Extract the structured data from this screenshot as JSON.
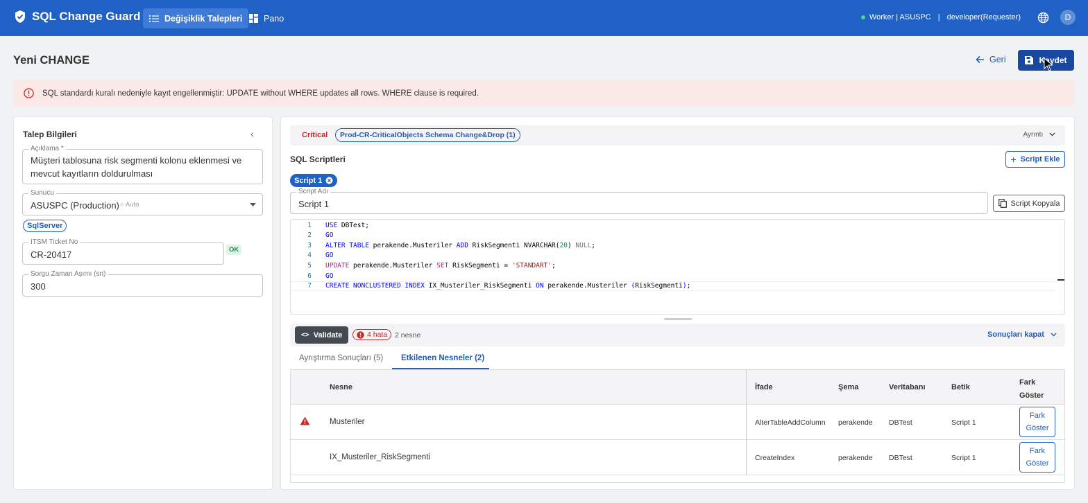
{
  "header": {
    "app_name": "SQL Change Guard",
    "nav": [
      {
        "label": "Değişiklik Talepleri",
        "active": true
      },
      {
        "label": "Pano",
        "active": false
      }
    ],
    "worker_status": "Worker | ASUSPC",
    "separator": "|",
    "user_role": "developer(Requester)",
    "avatar_initial": "D"
  },
  "page": {
    "title": "Yeni CHANGE",
    "back_label": "Geri",
    "save_label": "Kaydet"
  },
  "alert": {
    "message": "SQL standardı kuralı nedeniyle kayıt engellenmiştir: UPDATE without WHERE updates all rows. WHERE clause is required."
  },
  "request_info": {
    "title": "Talep Bilgileri",
    "description_label": "Açıklama *",
    "description_line1": "Müşteri tablosuna risk segmenti kolonu eklenmesi ve",
    "description_line2": "mevcut kayıtların doldurulması",
    "server_label": "Sunucu",
    "server_value": "ASUSPC (Production)",
    "server_hint": "Auto",
    "db_type_chip": "SqlServer",
    "itsm_label": "ITSM Ticket No",
    "itsm_value": "CR-20417",
    "itsm_status": "OK",
    "timeout_label": "Sorgu Zaman Aşımı (sn)",
    "timeout_value": "300"
  },
  "policy": {
    "level": "Critical",
    "rule_chip": "Prod-CR-CriticalObjects Schema Change&Drop (1)",
    "detail_label": "Ayrıntı"
  },
  "scripts": {
    "section_title": "SQL Scriptleri",
    "add_label": "Script Ekle",
    "tab_label": "Script 1",
    "name_label": "Script Adı",
    "name_value": "Script 1",
    "copy_label": "Script Kopyala",
    "lines": [
      {
        "n": "1",
        "parts": [
          [
            "kw",
            "USE"
          ],
          [
            "",
            " DBTest;"
          ]
        ]
      },
      {
        "n": "2",
        "parts": [
          [
            "kw",
            "GO"
          ]
        ]
      },
      {
        "n": "3",
        "parts": [
          [
            "kw",
            "ALTER TABLE"
          ],
          [
            "",
            " perakende.Musteriler "
          ],
          [
            "kw",
            "ADD"
          ],
          [
            "",
            " RiskSegmenti NVARCHAR("
          ],
          [
            "num",
            "20"
          ],
          [
            "",
            ") "
          ],
          [
            "gray",
            "NULL"
          ],
          [
            "",
            ";"
          ]
        ]
      },
      {
        "n": "4",
        "parts": [
          [
            "kw",
            "GO"
          ]
        ]
      },
      {
        "n": "5",
        "parts": [
          [
            "kw2",
            "UPDATE"
          ],
          [
            "",
            " perakende.Musteriler "
          ],
          [
            "kw2",
            "SET"
          ],
          [
            "",
            " RiskSegmenti = "
          ],
          [
            "str",
            "'STANDART'"
          ],
          [
            "",
            ";"
          ]
        ]
      },
      {
        "n": "6",
        "parts": [
          [
            "kw",
            "GO"
          ]
        ]
      },
      {
        "n": "7",
        "parts": [
          [
            "kw",
            "CREATE NONCLUSTERED INDEX"
          ],
          [
            "",
            " IX_Musteriler_RiskSegmenti "
          ],
          [
            "kw",
            "ON"
          ],
          [
            "",
            " perakende.Musteriler "
          ],
          [
            "kw",
            "("
          ],
          [
            "",
            "RiskSegmenti"
          ],
          [
            "kw",
            ")"
          ],
          [
            "",
            ";"
          ]
        ]
      }
    ]
  },
  "validation": {
    "button_label": "Validate",
    "error_count": "4 hata",
    "object_count": "2 nesne",
    "close_label": "Sonuçları kapat"
  },
  "result_tabs": [
    {
      "label": "Ayrıştırma Sonuçları (5)",
      "active": false
    },
    {
      "label": "Etkilenen Nesneler (2)",
      "active": true
    }
  ],
  "objects_table": {
    "headers": [
      "Nesne",
      "İfade",
      "Şema",
      "Veritabanı",
      "Betik",
      "Fark Göster"
    ],
    "rows": [
      {
        "warning": true,
        "object": "Musteriler",
        "statement": "AlterTableAddColumn",
        "schema": "perakende",
        "database": "DBTest",
        "script": "Script 1",
        "action": "Fark Göster"
      },
      {
        "warning": false,
        "object": "IX_Musteriler_RiskSegmenti",
        "statement": "CreateIndex",
        "schema": "perakende",
        "database": "DBTest",
        "script": "Script 1",
        "action": "Fark Göster"
      }
    ]
  },
  "colors": {
    "primary": "#1f61c4",
    "danger": "#c62828",
    "alert_bg": "#fbe9e8"
  }
}
